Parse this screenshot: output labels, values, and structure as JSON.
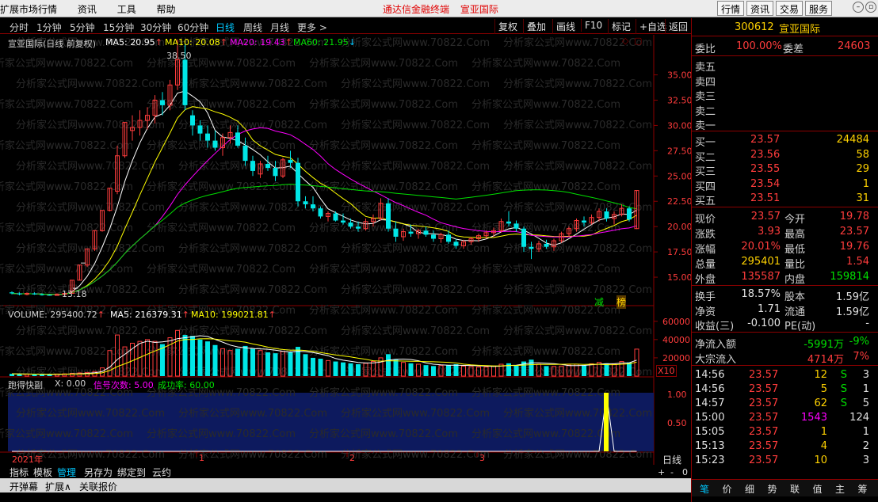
{
  "topbar": {
    "menu": [
      "扩展市场行情",
      "资讯",
      "工具",
      "帮助"
    ],
    "app_title": "通达信金融终端",
    "stock_title": "宣亚国际",
    "right_buttons": [
      "行情",
      "资讯",
      "交易",
      "服务"
    ]
  },
  "periodbar": {
    "periods": [
      "分时",
      "1分钟",
      "5分钟",
      "15分钟",
      "30分钟",
      "60分钟",
      "日线",
      "周线",
      "月线",
      "更多 >"
    ],
    "active": "日线",
    "right_buttons": [
      "复权",
      "叠加",
      "画线",
      "F10",
      "标记",
      "+自选",
      "返回"
    ]
  },
  "main_legend": {
    "title": "宣亚国际(日线 前复权)",
    "ma5": "MA5: 20.95",
    "ma10": "MA10: 20.08",
    "ma20": "MA20: 19.43",
    "ma60": "MA60: 21.95",
    "high_label": "38.50",
    "low_label": "13.18",
    "tag_jian": "减",
    "tag_bang": "榜"
  },
  "price_axis": [
    "35.00",
    "32.50",
    "30.00",
    "27.50",
    "25.00",
    "22.50",
    "20.00",
    "17.50",
    "15.00"
  ],
  "volume_legend": {
    "volume": "VOLUME: 295400.72",
    "ma5": "MA5: 216379.31",
    "ma10": "MA10: 199021.81",
    "unit": "X10"
  },
  "volume_axis": [
    "60000",
    "40000",
    "20000"
  ],
  "indicator_legend": {
    "name": "跑得快副",
    "x": "X: 0.00",
    "signals": "信号次数: 5.00",
    "success": "成功率: 60.00"
  },
  "indicator_axis": [
    "1.00",
    "0.50"
  ],
  "time_axis": {
    "year": "2021年",
    "months": [
      "1",
      "2",
      "3"
    ],
    "period": "日线",
    "zoom": [
      "+",
      "-",
      "0"
    ]
  },
  "bottom_tabs": [
    "指标",
    "模板",
    "管理",
    "另存为",
    "绑定到",
    "云约"
  ],
  "bottom_active": "管理",
  "statusbar": [
    "开弹幕",
    "扩展∧",
    "关联报价"
  ],
  "watermark": "分析家公式网www.70822.Com",
  "quote": {
    "code": "300612",
    "name": "宣亚国际",
    "webi_label": "委比",
    "webi": "100.00%",
    "wecha_label": "委差",
    "wecha": "24603",
    "sells": [
      {
        "label": "卖五"
      },
      {
        "label": "卖四"
      },
      {
        "label": "卖三"
      },
      {
        "label": "卖二"
      },
      {
        "label": "卖一"
      }
    ],
    "buys": [
      {
        "label": "买一",
        "price": "23.57",
        "vol": "24484"
      },
      {
        "label": "买二",
        "price": "23.56",
        "vol": "58"
      },
      {
        "label": "买三",
        "price": "23.55",
        "vol": "29"
      },
      {
        "label": "买四",
        "price": "23.54",
        "vol": "1"
      },
      {
        "label": "买五",
        "price": "23.51",
        "vol": "31"
      }
    ],
    "stats": [
      {
        "l1": "现价",
        "v1": "23.57",
        "c1": "red",
        "l2": "今开",
        "v2": "19.78",
        "c2": "red"
      },
      {
        "l1": "涨跌",
        "v1": "3.93",
        "c1": "red",
        "l2": "最高",
        "v2": "23.57",
        "c2": "red"
      },
      {
        "l1": "涨幅",
        "v1": "20.01%",
        "c1": "red",
        "l2": "最低",
        "v2": "19.76",
        "c2": "red"
      },
      {
        "l1": "总量",
        "v1": "295401",
        "c1": "yellow",
        "l2": "量比",
        "v2": "1.54",
        "c2": "red"
      },
      {
        "l1": "外盘",
        "v1": "135587",
        "c1": "red",
        "l2": "内盘",
        "v2": "159814",
        "c2": "green"
      }
    ],
    "stats2": [
      {
        "l1": "换手",
        "v1": "18.57%",
        "l2": "股本",
        "v2": "1.59亿"
      },
      {
        "l1": "净资",
        "v1": "1.71",
        "l2": "流通",
        "v2": "1.59亿"
      },
      {
        "l1": "收益(三)",
        "v1": "-0.100",
        "l2": "PE(动)",
        "v2": "-"
      }
    ],
    "flows": [
      {
        "label": "净流入额",
        "value": "-5991万",
        "pct": "-9%",
        "color": "green"
      },
      {
        "label": "大宗流入",
        "value": "4714万",
        "pct": "7%",
        "color": "red"
      }
    ],
    "ticks": [
      {
        "time": "14:56",
        "price": "23.57",
        "vol": "12",
        "vc": "yellow",
        "side": "S",
        "sc": "green",
        "n": "3"
      },
      {
        "time": "14:56",
        "price": "23.57",
        "vol": "5",
        "vc": "yellow",
        "side": "S",
        "sc": "green",
        "n": "1"
      },
      {
        "time": "14:57",
        "price": "23.57",
        "vol": "62",
        "vc": "yellow",
        "side": "S",
        "sc": "green",
        "n": "5"
      },
      {
        "time": "15:00",
        "price": "23.57",
        "vol": "1543",
        "vc": "magenta",
        "side": "",
        "sc": "white",
        "n": "124"
      },
      {
        "time": "15:05",
        "price": "23.57",
        "vol": "1",
        "vc": "yellow",
        "side": "",
        "sc": "white",
        "n": "1"
      },
      {
        "time": "15:13",
        "price": "23.57",
        "vol": "4",
        "vc": "yellow",
        "side": "",
        "sc": "white",
        "n": "2"
      },
      {
        "time": "15:23",
        "price": "23.57",
        "vol": "10",
        "vc": "yellow",
        "side": "",
        "sc": "white",
        "n": "3"
      }
    ],
    "tabs": [
      "笔",
      "价",
      "细",
      "势",
      "联",
      "值",
      "主",
      "筹"
    ],
    "tabs_active": "笔"
  },
  "colors": {
    "up": "#ff3c3c",
    "down": "#00e6e6",
    "ma5": "#ffffff",
    "ma10": "#ffff00",
    "ma20": "#ff00ff",
    "ma60": "#00e000",
    "border": "#8b0000",
    "indicator_bg": "#0d1a5e"
  },
  "chart_data": {
    "type": "candlestick",
    "price_range": [
      12.5,
      38.8
    ],
    "volume_range": [
      0,
      65000
    ],
    "candles": [
      [
        13.5,
        13.6,
        13.3,
        13.4,
        2500
      ],
      [
        13.4,
        13.5,
        13.2,
        13.3,
        2200
      ],
      [
        13.3,
        13.5,
        13.2,
        13.4,
        2000
      ],
      [
        13.4,
        13.5,
        13.25,
        13.3,
        1800
      ],
      [
        13.3,
        13.4,
        13.18,
        13.25,
        2100
      ],
      [
        13.25,
        13.3,
        13.18,
        13.2,
        1900
      ],
      [
        13.2,
        13.4,
        13.18,
        13.3,
        2300
      ],
      [
        13.3,
        13.5,
        13.2,
        13.4,
        2500
      ],
      [
        13.4,
        14.7,
        13.4,
        14.7,
        3000
      ],
      [
        14.7,
        16.2,
        14.7,
        16.2,
        3500
      ],
      [
        16.2,
        17.8,
        16.0,
        17.8,
        4000
      ],
      [
        17.8,
        19.6,
        17.6,
        19.6,
        5000
      ],
      [
        19.6,
        21.6,
        19.5,
        21.6,
        9000
      ],
      [
        21.6,
        23.8,
        21.5,
        23.8,
        28000
      ],
      [
        23.5,
        28.0,
        23.2,
        27.0,
        45000
      ],
      [
        27.0,
        30.3,
        26.8,
        30.3,
        32000
      ],
      [
        29.5,
        31.0,
        28.5,
        29.8,
        36000
      ],
      [
        29.8,
        31.5,
        29.0,
        30.5,
        38000
      ],
      [
        30.5,
        31.8,
        29.6,
        31.0,
        40000
      ],
      [
        31.0,
        33.0,
        30.2,
        32.5,
        38000
      ],
      [
        32.5,
        33.3,
        31.0,
        32.0,
        35000
      ],
      [
        32.0,
        34.5,
        31.5,
        34.0,
        42000
      ],
      [
        34.0,
        38.5,
        33.5,
        36.5,
        50000
      ],
      [
        36.5,
        38.0,
        31.5,
        32.0,
        45000
      ],
      [
        31.0,
        31.5,
        29.0,
        30.0,
        44000
      ],
      [
        30.0,
        30.5,
        28.5,
        29.2,
        40000
      ],
      [
        29.2,
        30.0,
        27.8,
        28.5,
        38000
      ],
      [
        28.5,
        29.5,
        27.5,
        27.8,
        34000
      ],
      [
        27.8,
        29.2,
        27.0,
        28.8,
        30000
      ],
      [
        28.8,
        30.0,
        28.2,
        29.3,
        28000
      ],
      [
        29.3,
        30.0,
        27.8,
        28.0,
        30000
      ],
      [
        28.0,
        28.8,
        26.0,
        26.5,
        33000
      ],
      [
        26.5,
        27.0,
        25.0,
        25.5,
        30000
      ],
      [
        25.2,
        26.5,
        24.8,
        26.2,
        28000
      ],
      [
        26.2,
        27.0,
        25.5,
        25.8,
        26000
      ],
      [
        25.8,
        26.5,
        24.5,
        25.0,
        25000
      ],
      [
        25.0,
        26.8,
        24.8,
        26.6,
        27000
      ],
      [
        26.6,
        27.5,
        25.8,
        26.3,
        26000
      ],
      [
        26.3,
        26.8,
        22.0,
        22.5,
        32000
      ],
      [
        22.5,
        23.0,
        21.8,
        22.2,
        24000
      ],
      [
        22.2,
        23.0,
        21.5,
        21.8,
        20000
      ],
      [
        21.8,
        22.0,
        20.8,
        21.0,
        19000
      ],
      [
        21.0,
        21.5,
        20.5,
        21.3,
        17000
      ],
      [
        21.3,
        21.5,
        20.5,
        20.6,
        16000
      ],
      [
        20.6,
        21.3,
        20.2,
        20.4,
        15000
      ],
      [
        20.4,
        20.8,
        19.8,
        20.0,
        14000
      ],
      [
        20.0,
        20.5,
        19.5,
        19.8,
        13000
      ],
      [
        19.8,
        20.8,
        19.6,
        20.5,
        14000
      ],
      [
        20.5,
        21.2,
        20.0,
        20.8,
        16000
      ],
      [
        20.8,
        22.8,
        20.6,
        22.3,
        20000
      ],
      [
        22.3,
        22.8,
        19.5,
        19.8,
        24000
      ],
      [
        19.8,
        20.5,
        18.5,
        19.0,
        18000
      ],
      [
        19.0,
        19.8,
        18.6,
        19.5,
        15000
      ],
      [
        19.5,
        20.2,
        19.0,
        19.3,
        14000
      ],
      [
        19.3,
        19.8,
        18.8,
        19.6,
        13000
      ],
      [
        19.6,
        20.0,
        19.0,
        19.2,
        12000
      ],
      [
        19.2,
        19.6,
        18.5,
        18.8,
        11000
      ],
      [
        18.8,
        19.4,
        18.4,
        19.2,
        11500
      ],
      [
        19.2,
        19.6,
        18.3,
        18.5,
        12000
      ],
      [
        18.5,
        18.8,
        17.8,
        18.1,
        13000
      ],
      [
        18.1,
        18.7,
        17.8,
        18.5,
        11000
      ],
      [
        18.5,
        19.0,
        18.2,
        18.8,
        10500
      ],
      [
        18.8,
        19.3,
        18.5,
        19.1,
        10000
      ],
      [
        19.1,
        19.6,
        18.8,
        19.4,
        10000
      ],
      [
        19.4,
        19.9,
        19.0,
        19.6,
        11000
      ],
      [
        19.6,
        20.8,
        19.4,
        20.5,
        13000
      ],
      [
        20.5,
        21.5,
        20.0,
        20.3,
        14000
      ],
      [
        20.3,
        20.6,
        19.5,
        19.8,
        12000
      ],
      [
        19.8,
        20.0,
        17.5,
        18.0,
        16000
      ],
      [
        18.0,
        18.5,
        16.8,
        17.8,
        18000
      ],
      [
        17.8,
        18.6,
        17.5,
        18.3,
        13000
      ],
      [
        18.3,
        18.7,
        17.8,
        18.0,
        11000
      ],
      [
        18.0,
        18.8,
        17.6,
        18.6,
        10500
      ],
      [
        18.6,
        19.5,
        18.4,
        19.3,
        11000
      ],
      [
        19.3,
        20.0,
        19.0,
        19.8,
        12000
      ],
      [
        19.8,
        20.8,
        19.5,
        20.6,
        13000
      ],
      [
        20.6,
        21.0,
        20.0,
        20.4,
        12000
      ],
      [
        20.4,
        21.2,
        20.2,
        20.9,
        13500
      ],
      [
        20.9,
        21.8,
        20.5,
        21.5,
        15000
      ],
      [
        21.5,
        21.8,
        20.5,
        20.8,
        14000
      ],
      [
        20.8,
        21.5,
        20.2,
        21.2,
        13000
      ],
      [
        21.2,
        22.2,
        21.0,
        21.8,
        16000
      ],
      [
        21.8,
        22.0,
        20.5,
        20.7,
        15000
      ],
      [
        19.8,
        23.57,
        19.76,
        23.57,
        29540
      ]
    ],
    "indicator": {
      "type": "signal",
      "spike_index": 79,
      "bar_index": 80
    }
  }
}
